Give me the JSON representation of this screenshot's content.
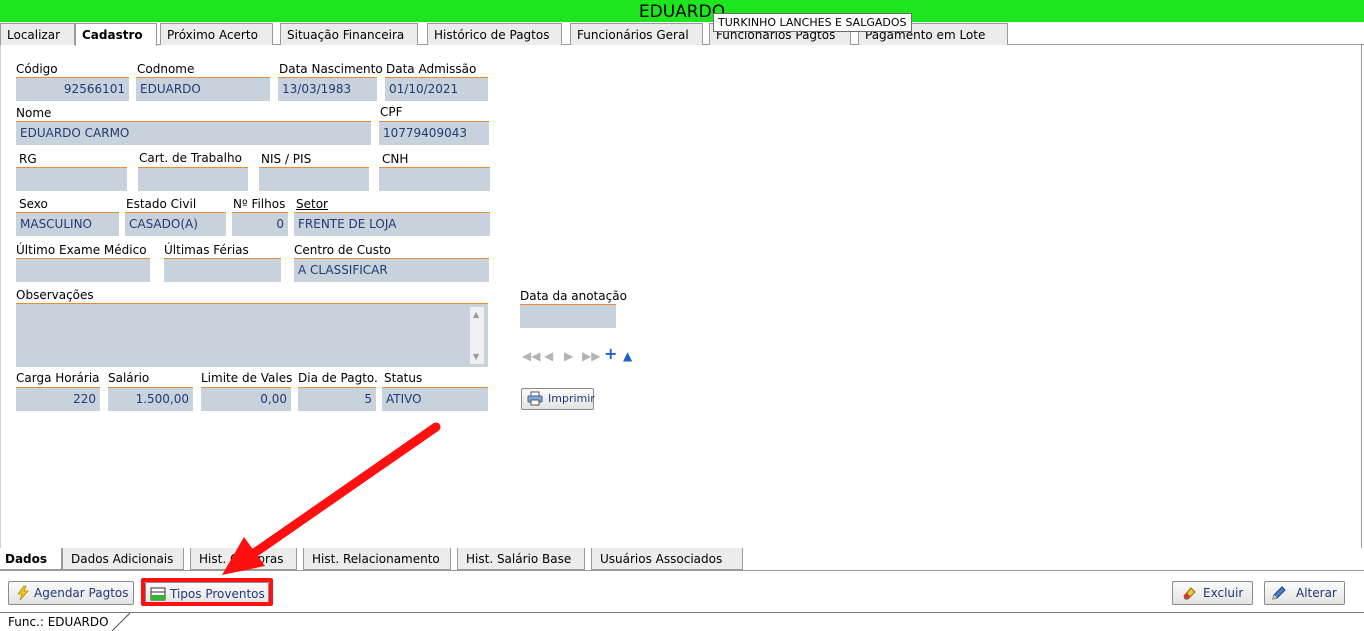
{
  "window": {
    "title": "EDUARDO",
    "tooltip": "TURKINHO LANCHES E SALGADOS"
  },
  "top_tabs": [
    {
      "label": "Localizar"
    },
    {
      "label": "Cadastro",
      "active": true
    },
    {
      "label": "Próximo Acerto"
    },
    {
      "label": "Situação Financeira"
    },
    {
      "label": "Histórico de Pagtos"
    },
    {
      "label": "Funcionários Geral"
    },
    {
      "label": "Funcionários Pagtos"
    },
    {
      "label": "Pagamento em Lote"
    }
  ],
  "form": {
    "codigo": {
      "label": "Código",
      "value": "92566101"
    },
    "codnome": {
      "label": "Codnome",
      "value": "EDUARDO"
    },
    "data_nascimento": {
      "label": "Data Nascimento",
      "value": "13/03/1983"
    },
    "data_admissao": {
      "label": "Data Admissão",
      "value": "01/10/2021"
    },
    "nome": {
      "label": "Nome",
      "value": "EDUARDO CARMO"
    },
    "cpf": {
      "label": "CPF",
      "value": "10779409043"
    },
    "rg": {
      "label": "RG",
      "value": ""
    },
    "cart_trabalho": {
      "label": "Cart. de Trabalho",
      "value": ""
    },
    "nis_pis": {
      "label": "NIS / PIS",
      "value": ""
    },
    "cnh": {
      "label": "CNH",
      "value": ""
    },
    "sexo": {
      "label": "Sexo",
      "value": "MASCULINO"
    },
    "estado_civil": {
      "label": "Estado Civil",
      "value": "CASADO(A)"
    },
    "n_filhos": {
      "label": "Nº Filhos",
      "value": "0"
    },
    "setor": {
      "label": "Setor",
      "value": "FRENTE DE LOJA"
    },
    "ultimo_exame": {
      "label": "Último Exame Médico",
      "value": ""
    },
    "ultimas_ferias": {
      "label": "Últimas Férias",
      "value": ""
    },
    "centro_custo": {
      "label": "Centro de Custo",
      "value": "A CLASSIFICAR"
    },
    "observacoes": {
      "label": "Observações",
      "value": ""
    },
    "data_anotacao": {
      "label": "Data da anotação",
      "value": ""
    },
    "carga_horaria": {
      "label": "Carga Horária",
      "value": "220"
    },
    "salario": {
      "label": "Salário",
      "value": "1.500,00"
    },
    "limite_vales": {
      "label": "Limite de Vales",
      "value": "0,00"
    },
    "dia_pagto": {
      "label": "Dia de Pagto.",
      "value": "5"
    },
    "status": {
      "label": "Status",
      "value": "ATIVO"
    }
  },
  "print_button": {
    "label": "Imprimir"
  },
  "bottom_tabs": [
    {
      "label": "Dados",
      "active": true
    },
    {
      "label": "Dados Adicionais"
    },
    {
      "label": "Hist. Compras"
    },
    {
      "label": "Hist. Relacionamento"
    },
    {
      "label": "Hist. Salário Base"
    },
    {
      "label": "Usuários Associados"
    }
  ],
  "actions": {
    "agendar": "Agendar Pagtos",
    "tipos": "Tipos Proventos",
    "excluir": "Excluir",
    "alterar": "Alterar"
  },
  "status_bar": {
    "text": "Func.: EDUARDO"
  },
  "colors": {
    "title_bg": "#1ee61e",
    "field_bg": "#c8d2dc",
    "field_border": "#e58e3a",
    "field_text": "#233a73",
    "highlight": "#ff0f0f"
  }
}
